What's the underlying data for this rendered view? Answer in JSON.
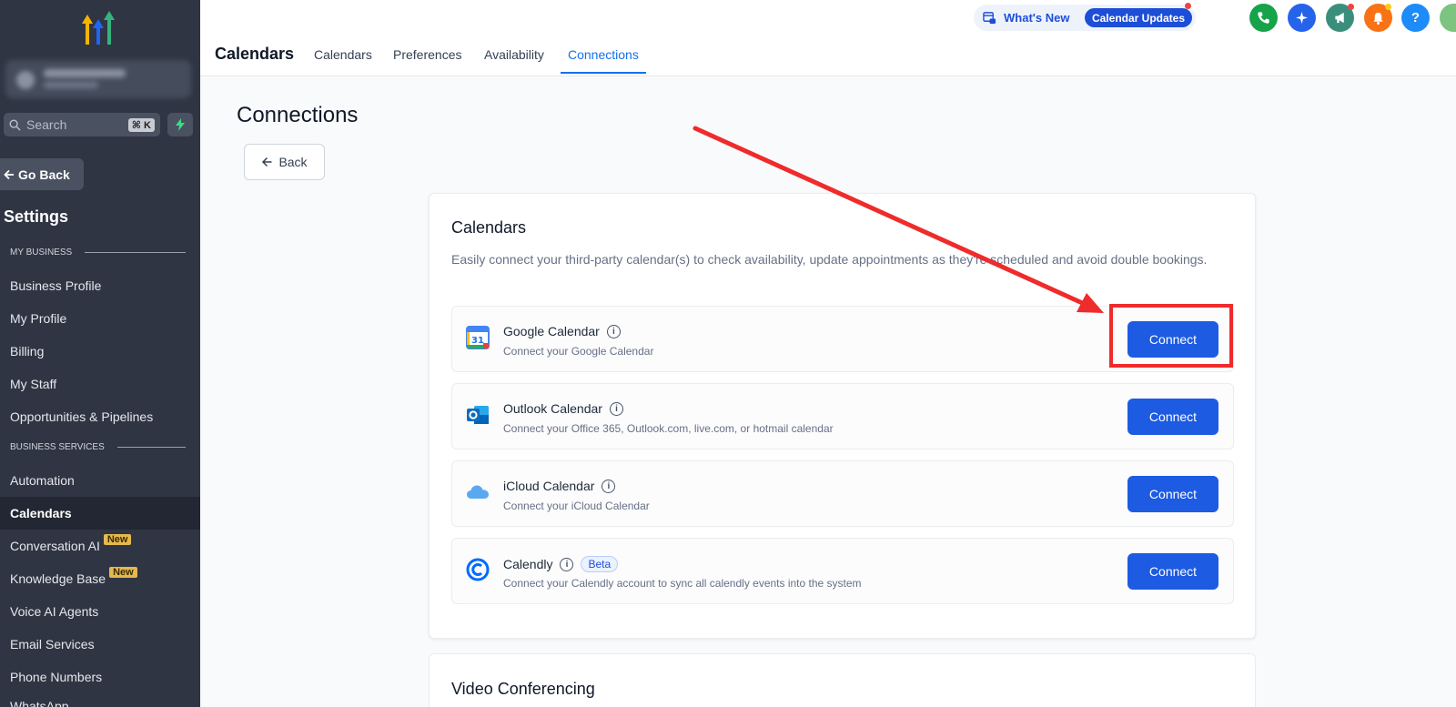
{
  "sidebar": {
    "search_placeholder": "Search",
    "search_shortcut": "⌘ K",
    "go_back": "Go Back",
    "settings_title": "Settings",
    "section_my_business": "MY BUSINESS",
    "section_business_services": "BUSINESS SERVICES",
    "items": [
      {
        "label": "Business Profile"
      },
      {
        "label": "My Profile"
      },
      {
        "label": "Billing"
      },
      {
        "label": "My Staff"
      },
      {
        "label": "Opportunities & Pipelines"
      },
      {
        "label": "Automation"
      },
      {
        "label": "Calendars"
      },
      {
        "label": "Conversation AI",
        "badge": "New"
      },
      {
        "label": "Knowledge Base",
        "badge": "New"
      },
      {
        "label": "Voice AI Agents"
      },
      {
        "label": "Email Services"
      },
      {
        "label": "Phone Numbers"
      },
      {
        "label": "WhatsApp"
      }
    ]
  },
  "header": {
    "title": "Calendars",
    "tabs": [
      {
        "label": "Calendars"
      },
      {
        "label": "Preferences"
      },
      {
        "label": "Availability"
      },
      {
        "label": "Connections"
      }
    ],
    "whats_new": "What's New",
    "calendar_updates": "Calendar Updates",
    "help_glyph": "?"
  },
  "main": {
    "page_title": "Connections",
    "back_label": "Back",
    "calendars_card": {
      "title": "Calendars",
      "description": "Easily connect your third-party calendar(s) to check availability, update appointments as they're scheduled and avoid double bookings.",
      "rows": [
        {
          "name": "Google Calendar",
          "sub": "Connect your Google Calendar",
          "button": "Connect"
        },
        {
          "name": "Outlook Calendar",
          "sub": "Connect your Office 365, Outlook.com, live.com, or hotmail calendar",
          "button": "Connect"
        },
        {
          "name": "iCloud Calendar",
          "sub": "Connect your iCloud Calendar",
          "button": "Connect"
        },
        {
          "name": "Calendly",
          "badge": "Beta",
          "sub": "Connect your Calendly account to sync all calendly events into the system",
          "button": "Connect"
        }
      ]
    },
    "video_card": {
      "title": "Video Conferencing"
    }
  },
  "colors": {
    "accent": "#1d5be3",
    "sidebar_bg": "#2f3543",
    "annotation": "#ef2b2b"
  }
}
